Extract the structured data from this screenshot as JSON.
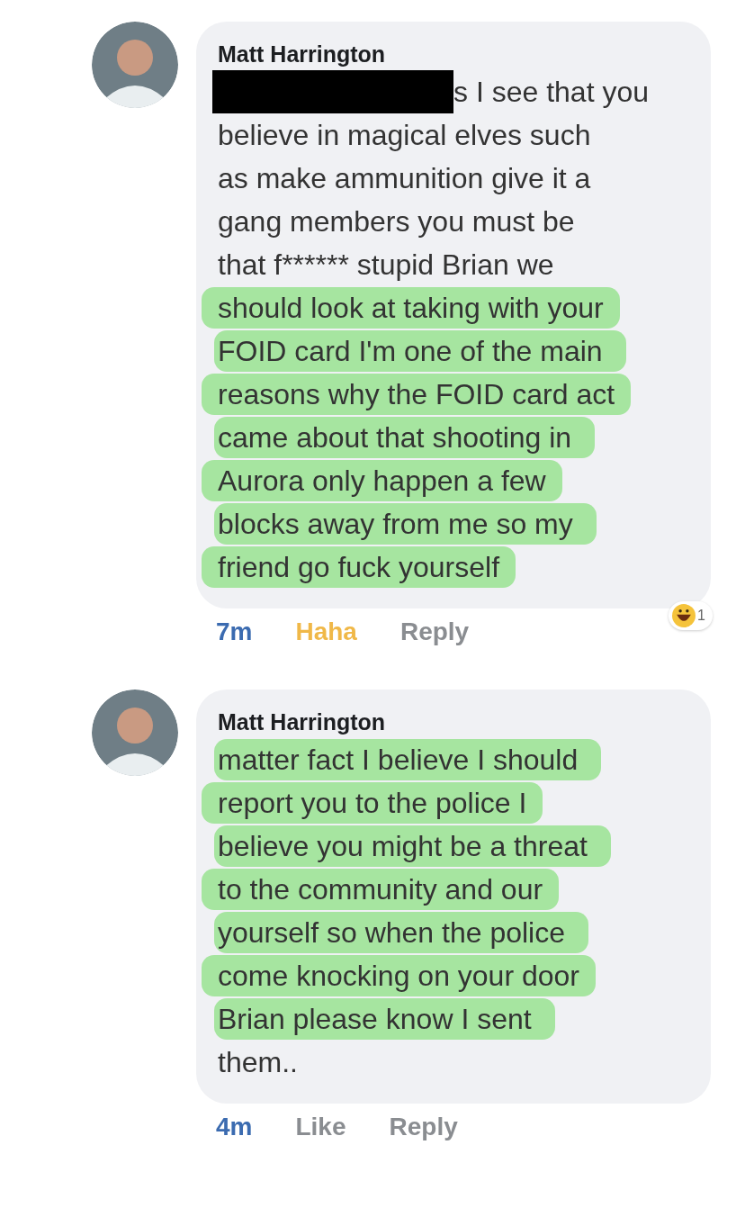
{
  "comments": [
    {
      "author": "Matt Harrington",
      "redacted": true,
      "lines": [
        {
          "text": "s I see that you",
          "highlighted": false
        },
        {
          "text": "believe in magical elves such",
          "highlighted": false
        },
        {
          "text": "as make ammunition give it a",
          "highlighted": false
        },
        {
          "text": "gang members you must be",
          "highlighted": false
        },
        {
          "text": "that f****** stupid Brian we",
          "highlighted": false
        },
        {
          "text": "should look at taking with your",
          "highlighted": true
        },
        {
          "text": "FOID card I'm one of the main",
          "highlighted": true
        },
        {
          "text": "reasons why the FOID card act",
          "highlighted": true
        },
        {
          "text": "came about that shooting in",
          "highlighted": true
        },
        {
          "text": "Aurora only happen a few",
          "highlighted": true
        },
        {
          "text": "blocks away from me so my",
          "highlighted": true
        },
        {
          "text": "friend go fuck yourself",
          "highlighted": true
        }
      ],
      "time": "7m",
      "reaction": "Haha",
      "reacted": true,
      "reply": "Reply",
      "reaction_count": "1"
    },
    {
      "author": "Matt Harrington",
      "redacted": false,
      "lines": [
        {
          "text": "matter fact I believe I should",
          "highlighted": true
        },
        {
          "text": "report you to the police I",
          "highlighted": true
        },
        {
          "text": "believe you might be a threat",
          "highlighted": true
        },
        {
          "text": "to the community and our",
          "highlighted": true
        },
        {
          "text": "yourself so when the police",
          "highlighted": true
        },
        {
          "text": "come knocking on your door",
          "highlighted": true
        },
        {
          "text": "Brian please know I sent",
          "highlighted": true
        },
        {
          "text": "them..",
          "highlighted": false
        }
      ],
      "time": "4m",
      "reaction": "Like",
      "reacted": false,
      "reply": "Reply"
    }
  ]
}
